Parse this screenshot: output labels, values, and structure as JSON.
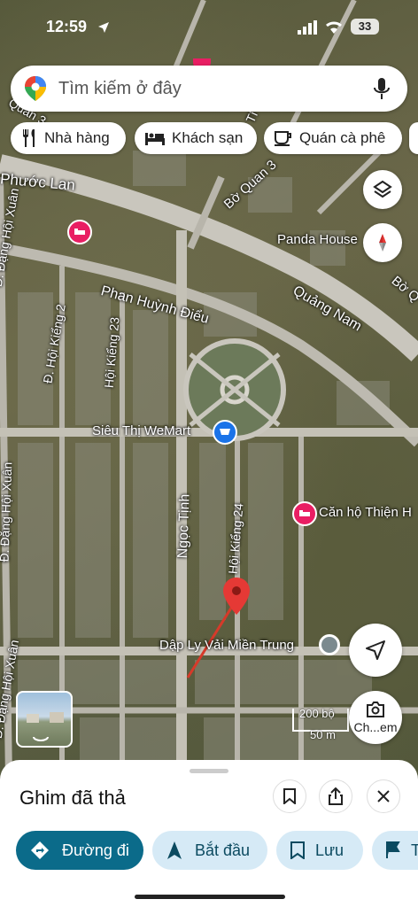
{
  "status_bar": {
    "time": "12:59",
    "battery": "33"
  },
  "search": {
    "placeholder": "Tìm kiếm ở đây"
  },
  "chips": [
    {
      "label": "Nhà hàng",
      "icon": "fork-knife-icon"
    },
    {
      "label": "Khách sạn",
      "icon": "bed-icon"
    },
    {
      "label": "Quán cà phê",
      "icon": "coffee-cup-icon"
    }
  ],
  "map_labels": {
    "phuoc_lan": "Phước Lan",
    "bo_quan_3": "Bờ Quan 3",
    "panda_house": "Panda House",
    "quang_nam": "Quảng Nam",
    "bo_q": "Bờ Q",
    "dang_hoi_xuan_top": "Đ. Đặng Hội Xuân",
    "phan_huynh_dieu": "Phan Huỳnh Điểu",
    "hoi_kieng_2": "Đ. Hội Kiểng 2",
    "hoi_kieng_23": "Hội Kiểng 23",
    "sieu_thi": "Siêu Thị WeMart",
    "can_ho": "Căn hộ Thiện H",
    "ngoc_tinh": "Ngọc Tịnh",
    "hoi_kieng_24": "Hội Kiểng 24",
    "dang_hoi_xuan_left": "Đ. Đặng Hội Xuân",
    "dap_ly": "Dập Ly Vải Miền Trung",
    "dang_hoi_xuan_bottom": "Đ. Đặng Hội Xuân",
    "scale_top": "200 bộ",
    "scale_bottom": "50 m",
    "tu": "Tí"
  },
  "buttons": {
    "camera_label": "Ch...em"
  },
  "sheet": {
    "title": "Ghim đã thả",
    "actions": [
      {
        "label": "Đường đi",
        "icon": "directions-icon"
      },
      {
        "label": "Bắt đầu",
        "icon": "navigation-arrow-icon"
      },
      {
        "label": "Lưu",
        "icon": "bookmark-icon"
      },
      {
        "label": "T",
        "icon": "flag-icon"
      }
    ]
  },
  "colors": {
    "accent": "#0b6b8a",
    "action_bg": "#d6eaf6",
    "pin": "#e53935",
    "hotel_pin": "#e91e63",
    "store_pin": "#1a73e8"
  }
}
